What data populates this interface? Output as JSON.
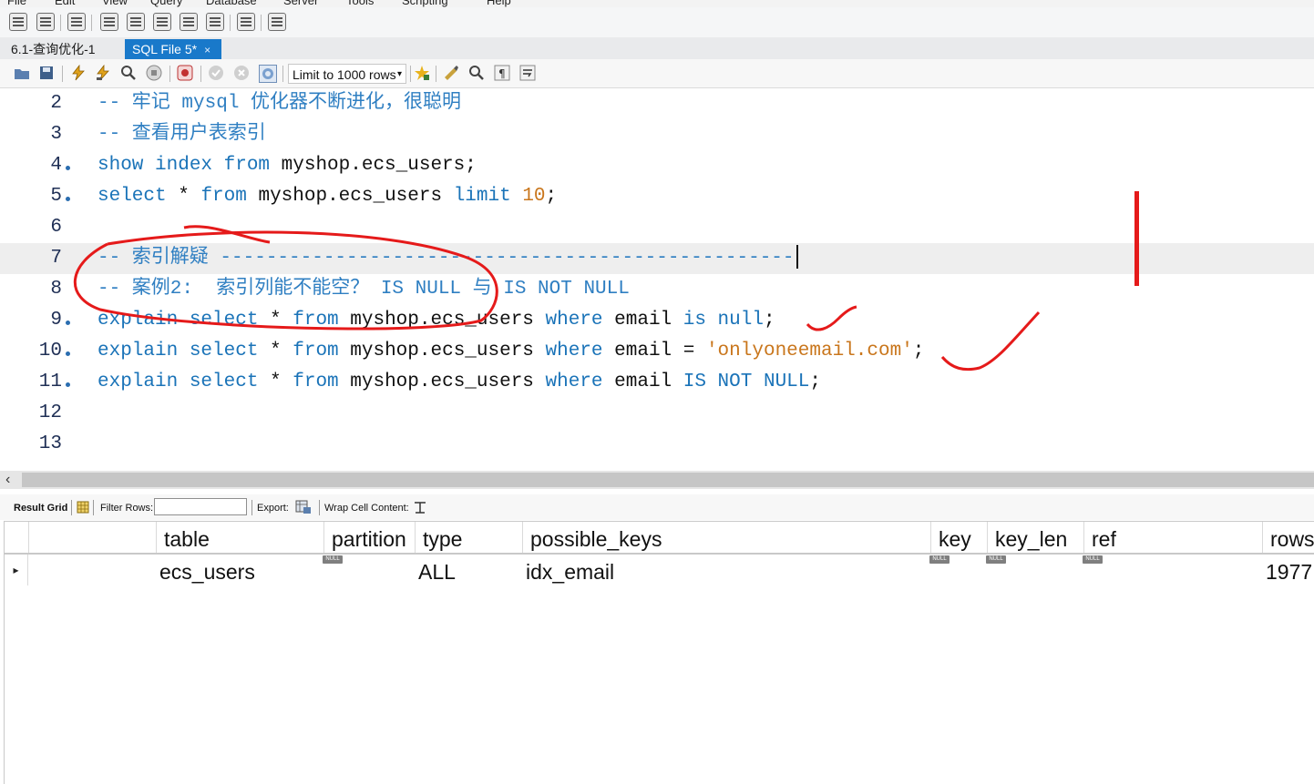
{
  "menu": [
    "File",
    "Edit",
    "View",
    "Query",
    "Database",
    "Server",
    "Tools",
    "Scripting",
    "Help"
  ],
  "tabs": [
    {
      "label": "6.1-查询优化-1"
    },
    {
      "label": "SQL File 5*",
      "close": "×"
    }
  ],
  "sql_toolbar": {
    "limit_label": "Limit to 1000 rows",
    "dropdown_arrow": "▾"
  },
  "editor": {
    "lines": [
      {
        "number": "2",
        "text": "-- 牢记 mysql 优化器不断进化，很聪明"
      },
      {
        "number": "3",
        "text": "-- 查看用户表索引"
      },
      {
        "number": "4",
        "k1": "show index from",
        "rest": " myshop.ecs_users;"
      },
      {
        "number": "5",
        "k1": "select",
        "t1": " * ",
        "k2": "from",
        "t2": " myshop.ecs_users ",
        "k3": "limit",
        "t3": " ",
        "num": "10",
        "t4": ";"
      },
      {
        "number": "6"
      },
      {
        "number": "7",
        "text": "-- 索引解疑 --------------------------------------------------"
      },
      {
        "number": "8",
        "text": "-- 案例2:  索引列能不能空？ IS NULL 与 IS NOT NULL"
      },
      {
        "number": "9",
        "k1": "explain select",
        "t1": " * ",
        "k2": "from",
        "t2": " myshop.ecs_users ",
        "k3": "where",
        "t3": " email ",
        "k4": "is null",
        "t4": ";"
      },
      {
        "number": "10",
        "k1": "explain select",
        "t1": " * ",
        "k2": "from",
        "t2": " myshop.ecs_users ",
        "k3": "where",
        "t3": " email = ",
        "str": "'onlyoneemail.com'",
        "t4": ";"
      },
      {
        "number": "11",
        "k1": "explain select",
        "t1": " * ",
        "k2": "from",
        "t2": " myshop.ecs_users ",
        "k3": "where",
        "t3": " email ",
        "k4": "IS NOT NULL",
        "t4": ";"
      },
      {
        "number": "12"
      },
      {
        "number": "13"
      }
    ]
  },
  "result_toolbar": {
    "result_grid": "Result Grid",
    "filter_rows": "Filter Rows:",
    "export": "Export:",
    "wrap": "Wrap Cell Content:"
  },
  "grid": {
    "columns": [
      "table",
      "partition",
      "type",
      "possible_keys",
      "key",
      "key_len",
      "ref",
      "rows"
    ],
    "null_badge": "NULL",
    "row": {
      "indicator": "▸",
      "table": "ecs_users",
      "type": "ALL",
      "possible_keys": "idx_email",
      "rows": "1977"
    }
  },
  "colors": {
    "accent": "#1979ca",
    "keyword": "#1a73b8",
    "comment": "#2f7fc2",
    "literal": "#c9761c",
    "annotation": "#e51a1a"
  }
}
